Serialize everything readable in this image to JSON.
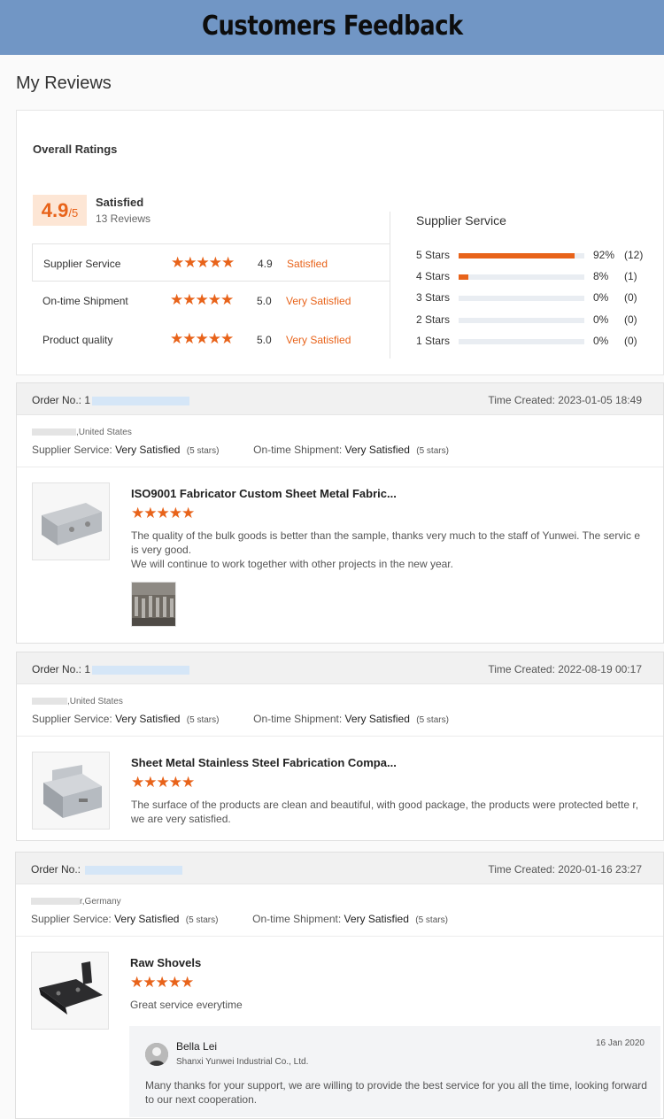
{
  "banner": {
    "title": "Customers Feedback",
    "bg_color": "#7196c5"
  },
  "page_title": "My Reviews",
  "accent_color": "#e8631a",
  "overall": {
    "title": "Overall Ratings",
    "score": "4.9",
    "score_suffix": "/5",
    "label": "Satisfied",
    "review_count": "13 Reviews",
    "rows": [
      {
        "label": "Supplier Service",
        "stars": "★★★★★",
        "score": "4.9",
        "status": "Satisfied"
      },
      {
        "label": "On-time Shipment",
        "stars": "★★★★★",
        "score": "5.0",
        "status": "Very Satisfied"
      },
      {
        "label": "Product quality",
        "stars": "★★★★★",
        "score": "5.0",
        "status": "Very Satisfied"
      }
    ]
  },
  "supplier_service": {
    "title": "Supplier Service",
    "distribution": [
      {
        "label": "5  Stars",
        "fraction": 0.92,
        "pct": "92%",
        "count": "(12)"
      },
      {
        "label": "4  Stars",
        "fraction": 0.08,
        "pct": "8%",
        "count": "(1)"
      },
      {
        "label": "3  Stars",
        "fraction": 0,
        "pct": "0%",
        "count": "(0)"
      },
      {
        "label": "2  Stars",
        "fraction": 0,
        "pct": "0%",
        "count": "(0)"
      },
      {
        "label": "1  Stars",
        "fraction": 0,
        "pct": "0%",
        "count": "(0)"
      }
    ]
  },
  "orders": [
    {
      "order_label": "Order No.:",
      "order_no_visible": "1",
      "time": "Time Created: 2023-01-05 18:49",
      "location": ",United States",
      "service_label": "Supplier Service:",
      "service_value": "Very Satisfied",
      "service_stars": "(5 stars)",
      "shipment_label": "On-time Shipment:",
      "shipment_value": "Very Satisfied",
      "shipment_stars": "(5 stars)",
      "product_title": "ISO9001 Fabricator Custom Sheet Metal Fabric...",
      "stars": "★★★★★",
      "comment_1": "The quality of the bulk goods is better than the sample, thanks very much to the staff of Yunwei. The servic e is very good.",
      "comment_2": "We will continue to work together with other projects in the new year."
    },
    {
      "order_label": "Order No.:",
      "order_no_visible": "1",
      "time": "Time Created: 2022-08-19 00:17",
      "location": ",United States",
      "service_label": "Supplier Service:",
      "service_value": "Very Satisfied",
      "service_stars": "(5 stars)",
      "shipment_label": "On-time Shipment:",
      "shipment_value": "Very Satisfied",
      "shipment_stars": "(5 stars)",
      "product_title": "Sheet Metal Stainless Steel Fabrication Compa...",
      "stars": "★★★★★",
      "comment_1": "The surface of the products are clean and beautiful, with good package, the products were protected bette r, we are very satisfied."
    },
    {
      "order_label": "Order No.:",
      "order_no_visible": "",
      "time": "Time Created: 2020-01-16 23:27",
      "location": "r,Germany",
      "service_label": "Supplier Service:",
      "service_value": "Very Satisfied",
      "service_stars": "(5 stars)",
      "shipment_label": "On-time Shipment:",
      "shipment_value": "Very Satisfied",
      "shipment_stars": "(5 stars)",
      "product_title": "Raw Shovels",
      "stars": "★★★★★",
      "comment_1": "Great service everytime",
      "reply": {
        "name": "Bella Lei",
        "company": "Shanxi Yunwei Industrial Co., Ltd.",
        "date": "16 Jan 2020",
        "text": "Many thanks for your support, we are willing to provide the best service for you all the time, looking forward to our next cooperation."
      }
    }
  ]
}
